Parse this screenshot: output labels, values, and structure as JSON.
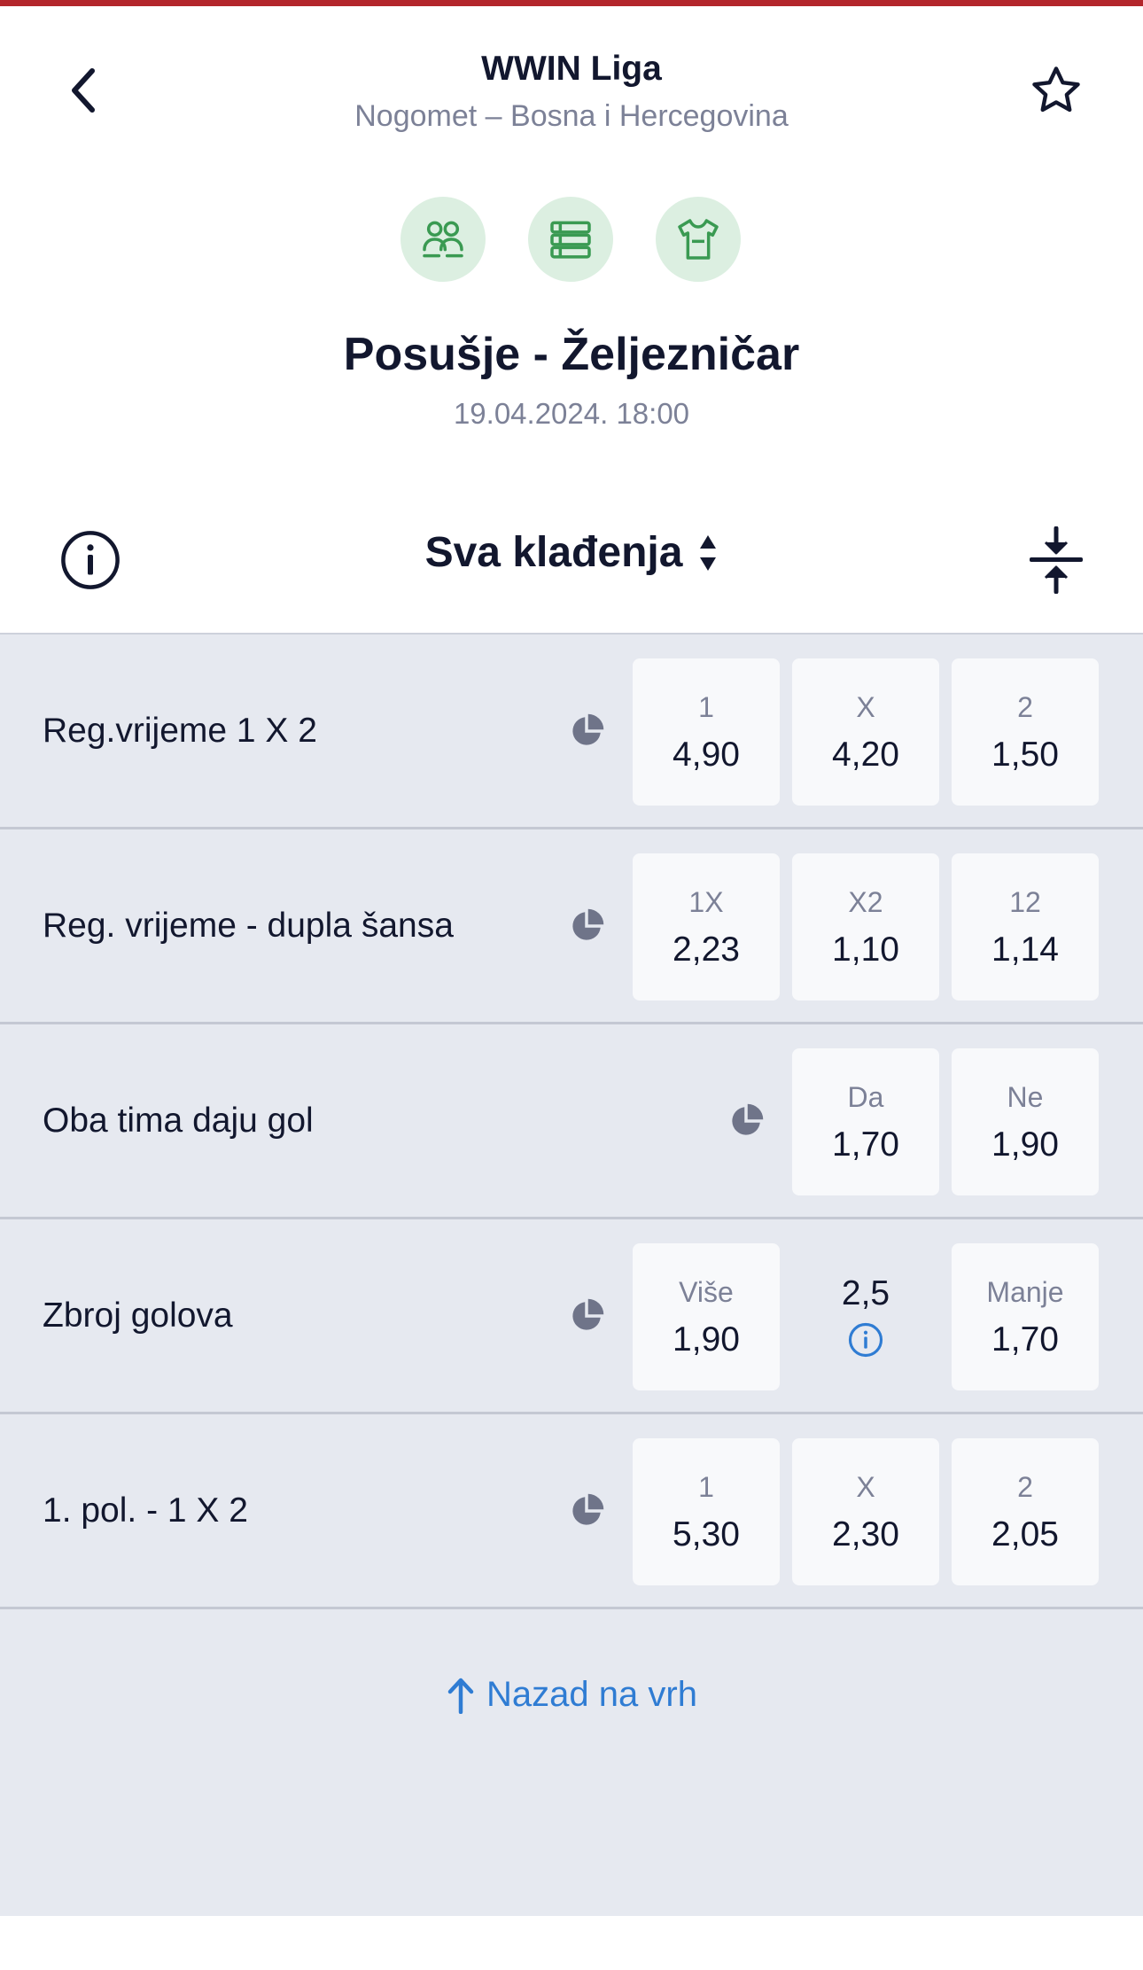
{
  "header": {
    "league_title": "WWIN Liga",
    "league_subtitle": "Nogomet – Bosna i Hercegovina",
    "back_icon": "chevron-left-icon",
    "favorite_icon": "star-outline-icon"
  },
  "tools": [
    {
      "icon": "head-to-head-icon"
    },
    {
      "icon": "standings-table-icon"
    },
    {
      "icon": "team-jersey-icon"
    }
  ],
  "match": {
    "title": "Posušje - Željezničar",
    "datetime": "19.04.2024. 18:00"
  },
  "filter": {
    "label": "Sva klađenja",
    "sort_icon": "sort-updown-icon",
    "info_icon": "info-circle-icon",
    "collapse_icon": "collapse-all-icon"
  },
  "markets": [
    {
      "name": "Reg.vrijeme 1 X 2",
      "odds": [
        {
          "label": "1",
          "value": "4,90"
        },
        {
          "label": "X",
          "value": "4,20"
        },
        {
          "label": "2",
          "value": "1,50"
        }
      ]
    },
    {
      "name": "Reg. vrijeme - dupla šansa",
      "odds": [
        {
          "label": "1X",
          "value": "2,23"
        },
        {
          "label": "X2",
          "value": "1,10"
        },
        {
          "label": "12",
          "value": "1,14"
        }
      ]
    },
    {
      "name": "Oba tima daju gol",
      "odds": [
        {
          "label": "Da",
          "value": "1,70"
        },
        {
          "label": "Ne",
          "value": "1,90"
        }
      ]
    },
    {
      "name": "Zbroj golova",
      "line": "2,5",
      "odds": [
        {
          "label": "Više",
          "value": "1,90"
        },
        {
          "label": "Manje",
          "value": "1,70"
        }
      ]
    },
    {
      "name": "1. pol. - 1 X 2",
      "odds": [
        {
          "label": "1",
          "value": "5,30"
        },
        {
          "label": "X",
          "value": "2,30"
        },
        {
          "label": "2",
          "value": "2,05"
        }
      ]
    }
  ],
  "back_to_top": {
    "label": "Nazad na vrh"
  },
  "colors": {
    "accent_red": "#b3262b",
    "accent_green": "#3a9a52",
    "link_blue": "#2f7cd3",
    "background_gray": "#e6e9f0"
  }
}
